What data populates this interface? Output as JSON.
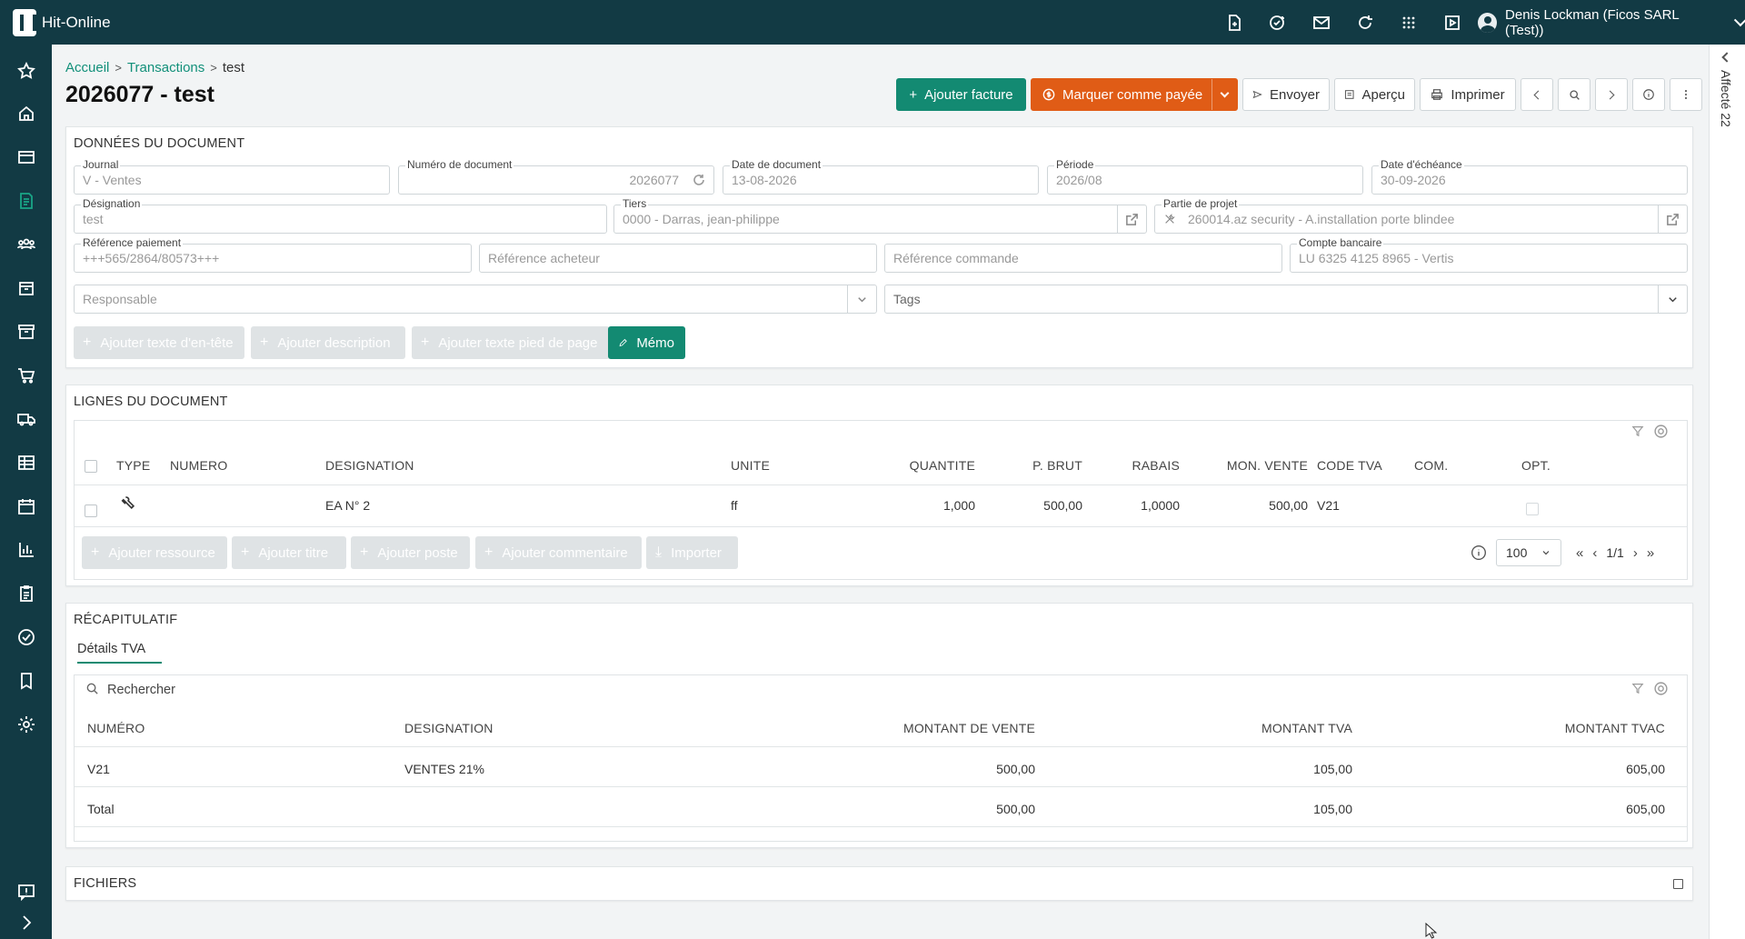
{
  "app": {
    "title": "Hit-Online"
  },
  "user": {
    "name": "Denis Lockman (Ficos SARL (Test))"
  },
  "topbar_icons": [
    "file-add-icon",
    "task-check-icon",
    "mail-icon",
    "refresh-icon",
    "apps-grid-icon",
    "video-icon"
  ],
  "sidebar": [
    "star-icon",
    "home-icon",
    "card-icon",
    "document-icon",
    "users-icon",
    "box-icon",
    "archive-icon",
    "cart-icon",
    "truck-icon",
    "ledger-icon",
    "calendar-icon",
    "chart-icon",
    "clipboard-icon",
    "check-circle-icon",
    "book-icon",
    "gear-icon",
    "feedback-icon",
    "expand-icon"
  ],
  "right_rail": {
    "label": "Affecté 22"
  },
  "breadcrumb": {
    "home": "Accueil",
    "transactions": "Transactions",
    "current": "test"
  },
  "page": {
    "title": "2026077 - test"
  },
  "toolbar": {
    "add_invoice": "Ajouter facture",
    "mark_paid": "Marquer comme payée",
    "send": "Envoyer",
    "preview": "Aperçu",
    "print": "Imprimer"
  },
  "document_data": {
    "section_title": "DONNÉES DU DOCUMENT",
    "journal_label": "Journal",
    "journal_value": "V - Ventes",
    "docnum_label": "Numéro de document",
    "docnum_value": "2026077",
    "docdate_label": "Date de document",
    "docdate_value": "13-08-2026",
    "period_label": "Période",
    "period_value": "2026/08",
    "due_label": "Date d'échéance",
    "due_value": "30-09-2026",
    "designation_label": "Désignation",
    "designation_value": "test",
    "tiers_label": "Tiers",
    "tiers_value": "0000 - Darras, jean-philippe",
    "project_label": "Partie de projet",
    "project_value": "260014.az security - A.installation porte blindee",
    "payref_label": "Référence paiement",
    "payref_value": "+++565/2864/80573+++",
    "buyerref_placeholder": "Référence acheteur",
    "orderref_placeholder": "Référence commande",
    "bank_label": "Compte bancaire",
    "bank_value": "LU 6325 4125 8965 - Vertis",
    "responsible_placeholder": "Responsable",
    "tags_placeholder": "Tags",
    "btn_header_text": "Ajouter texte d'en-tête",
    "btn_description": "Ajouter description",
    "btn_footer_text": "Ajouter texte pied de page",
    "btn_memo": "Mémo"
  },
  "lines": {
    "section_title": "LIGNES DU DOCUMENT",
    "columns": [
      "TYPE",
      "NUMERO",
      "DESIGNATION",
      "UNITE",
      "QUANTITE",
      "P. BRUT",
      "RABAIS",
      "MON. VENTE",
      "CODE TVA",
      "COM.",
      "OPT."
    ],
    "rows": [
      {
        "type_icon": "wrench-icon",
        "numero": "",
        "designation": "EA N° 2",
        "unite": "ff",
        "quantite": "1,000",
        "p_brut": "500,00",
        "rabais": "1,0000",
        "mon_vente": "500,00",
        "code_tva": "V21",
        "com": ""
      }
    ],
    "btn_add_resource": "Ajouter ressource",
    "btn_add_title": "Ajouter titre",
    "btn_add_post": "Ajouter poste",
    "btn_add_comment": "Ajouter commentaire",
    "btn_import": "Importer",
    "page_size": "100",
    "page_indicator": "1/1"
  },
  "summary": {
    "section_title": "RÉCAPITULATIF",
    "tab_vat": "Détails TVA",
    "search_placeholder": "Rechercher",
    "columns": [
      "NUMÉRO",
      "DESIGNATION",
      "MONTANT DE VENTE",
      "MONTANT TVA",
      "MONTANT TVAC"
    ],
    "rows": [
      {
        "numero": "V21",
        "designation": "VENTES 21%",
        "vente": "500,00",
        "tva": "105,00",
        "tvac": "605,00"
      },
      {
        "numero": "Total",
        "designation": "",
        "vente": "500,00",
        "tva": "105,00",
        "tvac": "605,00"
      }
    ]
  },
  "files": {
    "section_title": "FICHIERS"
  },
  "colors": {
    "header": "#123a44",
    "accent_green": "#138a72",
    "accent_orange": "#e05c16"
  }
}
